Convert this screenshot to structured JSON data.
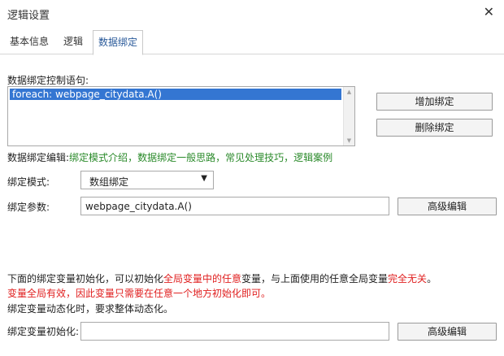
{
  "dialog": {
    "title": "逻辑设置",
    "close_glyph": "✕"
  },
  "tabs": [
    {
      "label": "基本信息",
      "active": false
    },
    {
      "label": "逻辑",
      "active": false
    },
    {
      "label": "数据绑定",
      "active": true
    }
  ],
  "binding": {
    "control_label": "数据绑定控制语句:",
    "statements": [
      "foreach: webpage_citydata.A()"
    ],
    "add_button": "增加绑定",
    "delete_button": "删除绑定",
    "edit_prefix": "数据绑定编辑:",
    "edit_links": [
      "绑定模式介绍",
      "数据绑定一般思路",
      "常见处理技巧",
      "逻辑案例"
    ],
    "link_separator": "，",
    "mode_label": "绑定模式:",
    "mode_value": "数组绑定",
    "param_label": "绑定参数:",
    "param_value": "webpage_citydata.A()",
    "advanced_edit_button": "高级编辑"
  },
  "notes": {
    "line1_a": "下面的绑定变量初始化，可以初始化",
    "line1_b": "全局变量中的任意",
    "line1_c": "变量，与上面使用的任意全局变量",
    "line1_d": "完全无关",
    "line1_e": "。",
    "line2": "变量全局有效，因此变量只需要在任意一个地方初始化即可。",
    "line3": "绑定变量动态化时，要求整体动态化。"
  },
  "init": {
    "label": "绑定变量初始化:",
    "value": "",
    "advanced_edit_button": "高级编辑"
  },
  "colors": {
    "link_green": "#2a8a2a",
    "warning_red": "#e02020",
    "selection_blue": "#3476d2",
    "active_tab_text": "#2a5a9a"
  }
}
